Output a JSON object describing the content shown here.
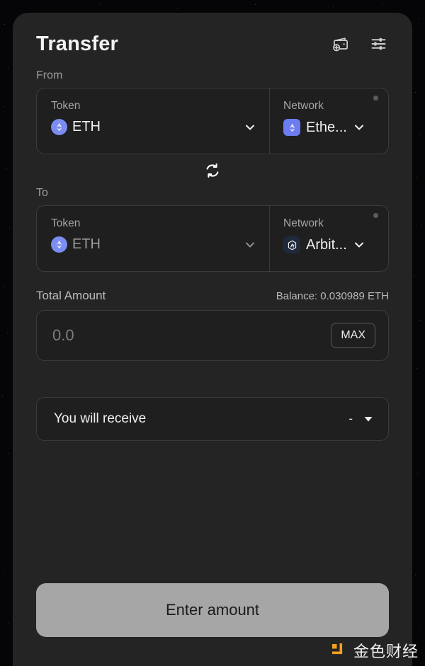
{
  "header": {
    "title": "Transfer",
    "wallet_icon": "wallet-add-icon",
    "settings_icon": "sliders-settings-icon"
  },
  "from": {
    "section_label": "From",
    "token": {
      "label": "Token",
      "value": "ETH",
      "logo": "ethereum-round-icon",
      "chevron": "chevron-down-icon"
    },
    "network": {
      "label": "Network",
      "value": "Ethe...",
      "logo": "ethereum-square-icon",
      "chevron": "chevron-down-icon",
      "status_dot": "status-dot"
    }
  },
  "swap": {
    "icon": "swap-arrows-icon"
  },
  "to": {
    "section_label": "To",
    "token": {
      "label": "Token",
      "value": "ETH",
      "logo": "ethereum-round-icon",
      "chevron": "chevron-down-icon"
    },
    "network": {
      "label": "Network",
      "value": "Arbit...",
      "logo": "arbitrum-square-icon",
      "chevron": "chevron-down-icon",
      "status_dot": "status-dot"
    }
  },
  "amount": {
    "title": "Total Amount",
    "balance": "Balance: 0.030989 ETH",
    "placeholder": "0.0",
    "value": "",
    "max_label": "MAX"
  },
  "receive": {
    "label": "You will receive",
    "value": "-",
    "caret": "caret-down-icon"
  },
  "cta": {
    "label": "Enter amount"
  },
  "watermark": {
    "text": "金色财经",
    "mark": "jinse-logo-icon",
    "color": "#f0a020"
  },
  "colors": {
    "panel_bg": "#242424",
    "field_bg": "#1f1f1f",
    "border": "#3b3b3b",
    "accent_eth": "#7b8df0",
    "accent_arb": "#20293c",
    "cta_bg": "#a6a6a6"
  }
}
